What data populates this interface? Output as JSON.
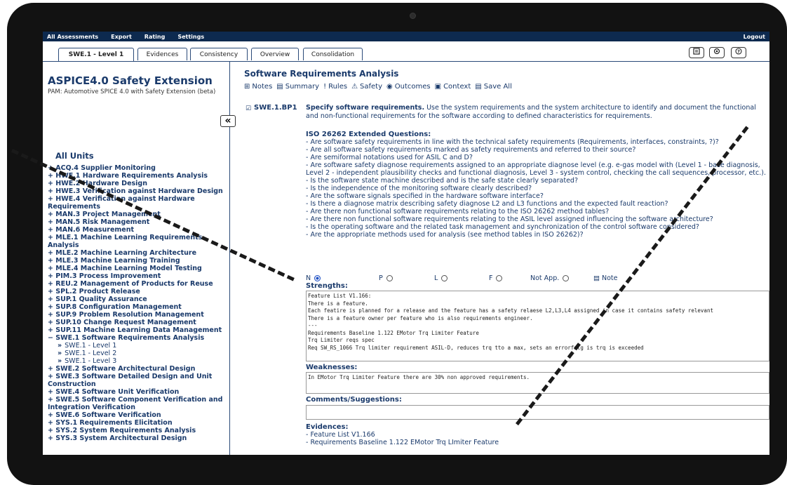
{
  "topnav": {
    "items": [
      "All Assessments",
      "Export",
      "Rating",
      "Settings"
    ],
    "logout": "Logout"
  },
  "tabs": [
    "SWE.1 - Level 1",
    "Evidences",
    "Consistency",
    "Overview",
    "Consolidation"
  ],
  "app_title": "ASPICE4.0 Safety Extension",
  "pam": "PAM: Automotive SPICE 4.0 with Safety Extension (beta)",
  "collapse_label": "«",
  "all_units_label": "All Units",
  "units": [
    {
      "label": "+ ACQ.4 Supplier Monitoring"
    },
    {
      "label": "+ HWE.1 Hardware Requirements Analysis"
    },
    {
      "label": "+ HWE.2 Hardware Design"
    },
    {
      "label": "+ HWE.3 Verification against Hardware Design"
    },
    {
      "label": "+ HWE.4 Verification against Hardware Requirements"
    },
    {
      "label": "+ MAN.3 Project Management"
    },
    {
      "label": "+ MAN.5 Risk Management"
    },
    {
      "label": "+ MAN.6 Measurement"
    },
    {
      "label": "+ MLE.1 Machine Learning Requirements Analysis"
    },
    {
      "label": "+ MLE.2 Machine Learning Architecture"
    },
    {
      "label": "+ MLE.3 Machine Learning Training"
    },
    {
      "label": "+ MLE.4 Machine Learning Model Testing"
    },
    {
      "label": "+ PIM.3 Process Improvement"
    },
    {
      "label": "+ REU.2 Management of Products for Reuse"
    },
    {
      "label": "+ SPL.2 Product Release"
    },
    {
      "label": "+ SUP.1 Quality Assurance"
    },
    {
      "label": "+ SUP.8 Configuration Management"
    },
    {
      "label": "+ SUP.9 Problem Resolution Management"
    },
    {
      "label": "+ SUP.10 Change Request Management"
    },
    {
      "label": "+ SUP.11 Machine Learning Data Management"
    },
    {
      "label": "− SWE.1 Software Requirements Analysis"
    },
    {
      "label": "SWE.1 - Level 1",
      "sub": true
    },
    {
      "label": "SWE.1 - Level 2",
      "sub": true
    },
    {
      "label": "SWE.1 - Level 3",
      "sub": true
    },
    {
      "label": "+ SWE.2 Software Architectural Design"
    },
    {
      "label": "+ SWE.3 Software Detailed Design and Unit Construction"
    },
    {
      "label": "+ SWE.4 Software Unit Verification"
    },
    {
      "label": "+ SWE.5 Software Component Verification and Integration Verification"
    },
    {
      "label": "+ SWE.6 Software Verification"
    },
    {
      "label": "+ SYS.1 Requirements Elicitation"
    },
    {
      "label": "+ SYS.2 System Requirements Analysis"
    },
    {
      "label": "+ SYS.3 System Architectural Design"
    }
  ],
  "main": {
    "title": "Software Requirements Analysis",
    "toolbar": [
      {
        "icon": "⊞",
        "label": "Notes"
      },
      {
        "icon": "▤",
        "label": "Summary"
      },
      {
        "icon": "!",
        "label": "Rules"
      },
      {
        "icon": "⚠",
        "label": "Safety"
      },
      {
        "icon": "◉",
        "label": "Outcomes"
      },
      {
        "icon": "▣",
        "label": "Context"
      },
      {
        "icon": "▤",
        "label": "Save All"
      }
    ],
    "bp_id": "SWE.1.BP1",
    "bp_heading": "Specify software requirements.",
    "bp_text": " Use the system requirements and the system architecture to identify and document the functional and non-functional requirements for the software according to defined characteristics for requirements.",
    "iso_title": "ISO 26262 Extended Questions:",
    "questions": [
      "- Are software safety requirements in line with the technical safety requirements (Requirements, interfaces, constraints, ?)?",
      "- Are all software safety requirements marked as safety requirements and referred to their source?",
      "- Are semiformal notations used for ASIL C and D?",
      "- Are software safety diagnose requirements assigned to an appropriate diagnose level (e.g. e-gas model with (Level 1 - base diagnosis, Level 2 - independent plausibility checks and functional diagnosis, Level 3 - system control, checking the call sequences, processor, etc.).",
      "- Is the software state machine described and is the safe state clearly separated?",
      "- Is the independence of the monitoring software clearly described?",
      "- Are the software signals specified in the hardware software interface?",
      "- Is there a diagnose matrix describing safety diagnose L2 and L3 functions and the expected fault reaction?",
      "- Are there non functional software requirements relating to the ISO 26262 method tables?",
      "- Are there non functional software requirements relating to the ASIL level assigned influencing the software architecture?",
      "- Is the operating software and the related task management and synchronization of the control software considered?",
      "- Are the appropriate methods used for analysis (see method tables in ISO 26262)?"
    ],
    "ratings": [
      {
        "label": "N",
        "selected": true
      },
      {
        "label": "P",
        "selected": false
      },
      {
        "label": "L",
        "selected": false
      },
      {
        "label": "F",
        "selected": false
      },
      {
        "label": "Not App.",
        "selected": false
      }
    ],
    "note_label": "Note",
    "strengths_label": "Strengths:",
    "strengths": [
      "Feature List V1.166:",
      "There is a feature.",
      "Each featire is planned for a release and the feature has a safety relaese L2,L3,L4 assigned in case it contains safety relevant",
      "There is a feature owner per feature who is also requirements engineer.",
      "---",
      "Requirements Baseline 1.122 EMotor Trq Limiter Feature",
      "Trq Limiter reqs spec",
      "Req SW_RS_1066 Trq limiter requirement ASIL-D, reduces trq tto a max, sets an errorfalg is trq is exceeded"
    ],
    "weaknesses_label": "Weaknesses:",
    "weaknesses": [
      "In EMotor Trq Limiter Feature there are 30% non approved requirements."
    ],
    "comments_label": "Comments/Suggestions:",
    "comments": [],
    "evidences_label": "Evidences:",
    "evidences": [
      "- Feature List V1.166",
      "- Requirements Baseline 1.122 EMotor Trq LImiter Feature"
    ]
  },
  "header_icons": [
    "document-icon",
    "gear-icon",
    "help-icon"
  ]
}
